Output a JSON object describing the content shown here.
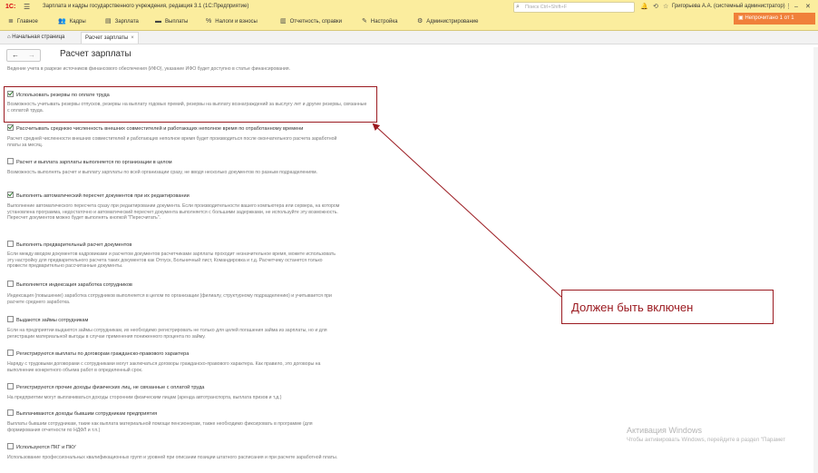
{
  "titlebar": {
    "logo": "1С:",
    "title": "Зарплата и кадры государственного учреждения, редакция 3.1  (1С:Предприятие)",
    "search_placeholder": "Поиск Ctrl+Shift+F",
    "user": "Григорьева А.А. (системный администратор)"
  },
  "menu": {
    "items": [
      {
        "label": "Главное",
        "icon": "menu-lines-icon"
      },
      {
        "label": "Кадры",
        "icon": "people-icon"
      },
      {
        "label": "Зарплата",
        "icon": "salary-icon"
      },
      {
        "label": "Выплаты",
        "icon": "payments-icon"
      },
      {
        "label": "Налоги и взносы",
        "icon": "percent-icon"
      },
      {
        "label": "Отчетность, справки",
        "icon": "report-icon"
      },
      {
        "label": "Настройка",
        "icon": "wrench-icon"
      },
      {
        "label": "Администрирование",
        "icon": "gear-icon"
      }
    ],
    "notice": "Непрочитано 1 от 1"
  },
  "tabs": [
    {
      "label": "Начальная страница",
      "icon": "home-icon"
    },
    {
      "label": "Расчет зарплаты",
      "active": true
    }
  ],
  "page": {
    "title": "Расчет зарплаты",
    "intro": "Ведение учета в разрезе источников финансового обеспечения (ИФО), указание ИФО будет доступно в статье финансирования."
  },
  "options": [
    {
      "label": "Использовать резервы по оплате труда",
      "checked": true,
      "desc": "Возможность учитывать резервы отпусков, резервы на выплату годовых премий, резервы на выплату вознаграждений за выслугу лет и другие резервы, связанные с оплатой труда."
    },
    {
      "label": "Рассчитывать среднюю численность внешних совместителей и работающих неполное время по отработанному времени",
      "checked": true,
      "desc": "Расчет средней численности внешних совместителей и работающих неполное время будет производиться после окончательного расчета заработной платы за месяц."
    },
    {
      "label": "Расчет и выплата зарплаты выполняется по организации в целом",
      "checked": false,
      "desc": "Возможность выполнять расчет и выплату зарплаты по всей организации сразу, не вводя несколько документов по разным подразделениям."
    },
    {
      "label": "Выполнять автоматический пересчет документов при их редактировании",
      "checked": true,
      "desc": "Выполнение автоматического пересчета сразу при редактировании документа. Если производительности вашего компьютера или сервера, на котором установлена программа, недостаточно и автоматический пересчет документа выполняется с большими задержками, не используйте эту возможность. Пересчет документов можно будет выполнять кнопкой \"Пересчитать\"."
    },
    {
      "label": "Выполнять предварительный расчет документов",
      "checked": false,
      "desc": "Если между вводом документов кадровиками и расчетом документов расчетчиками зарплаты проходит незначительное время, можете использовать эту настройку для предварительного расчета таких документов как Отпуск, Больничный лист, Командировка и т.д. Расчетчику останется только провести предварительно рассчитанные документы."
    },
    {
      "label": "Выполняется индексация заработка сотрудников",
      "checked": false,
      "desc": "Индексация (повышение) заработка сотрудников выполняется в целом по организации (филиалу, структурному подразделению) и учитывается при расчете среднего заработка."
    },
    {
      "label": "Выдаются займы сотрудникам",
      "checked": false,
      "desc": "Если на предприятии выдаются займы сотрудникам, их необходимо регистрировать не только для целей погашения займа из зарплаты, но и для регистрации материальной выгоды в случае применения пониженного процента по займу."
    },
    {
      "label": "Регистрируются выплаты по договорам гражданско-правового характера",
      "checked": false,
      "desc": "Наряду с трудовыми договорами с сотрудниками могут заключаться договоры гражданско-правового характера. Как правило, это договоры на выполнение конкретного объема работ в определенный срок."
    },
    {
      "label": "Регистрируются прочие доходы физических лиц, не связанные с оплатой труда",
      "checked": false,
      "desc": "На предприятии могут выплачиваться доходы сторонним физическим лицам (аренда автотранспорта, выплата призов и т.д.)"
    },
    {
      "label": "Выплачиваются доходы бывшим сотрудникам предприятия",
      "checked": false,
      "desc": "Выплаты бывшим сотрудникам, такие как выплата материальной помощи пенсионерам, также необходимо фиксировать в программе (для формирования отчетности по НДФЛ и т.п.)"
    },
    {
      "label": "Используются ПКГ и ПКУ",
      "checked": false,
      "desc": "Использование профессиональных квалификационных групп и уровней при описании позиции штатного расписания и при расчете заработной платы."
    }
  ],
  "annotation": {
    "callout": "Должен быть включен",
    "color": "#9b1b21"
  },
  "watermark": {
    "line1": "Активация Windows",
    "line2": "Чтобы активировать Windows, перейдите в раздел \"Парамет"
  }
}
